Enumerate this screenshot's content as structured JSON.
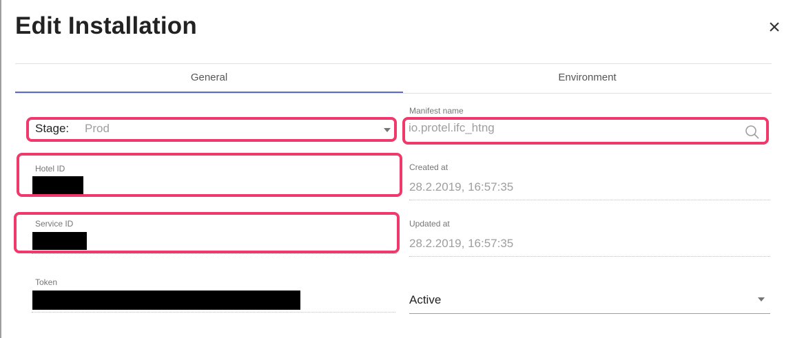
{
  "dialog": {
    "title": "Edit Installation",
    "close_icon": "close-icon",
    "tabs": [
      {
        "label": "General",
        "active": true
      },
      {
        "label": "Environment",
        "active": false
      }
    ],
    "accent_color": "#5c6bc0",
    "highlight_color": "#f0386b"
  },
  "form": {
    "stage": {
      "label": "Stage:",
      "value": "Prod"
    },
    "manifest_name": {
      "label": "Manifest name",
      "value": "io.protel.ifc_htng",
      "icon": "search-icon"
    },
    "hotel_id": {
      "label": "Hotel ID",
      "value_redacted": true
    },
    "created_at": {
      "label": "Created at",
      "value": "28.2.2019, 16:57:35"
    },
    "service_id": {
      "label": "Service ID",
      "value_redacted": true
    },
    "updated_at": {
      "label": "Updated at",
      "value": "28.2.2019, 16:57:35"
    },
    "token": {
      "label": "Token",
      "value_redacted": true
    },
    "status": {
      "value": "Active"
    }
  }
}
